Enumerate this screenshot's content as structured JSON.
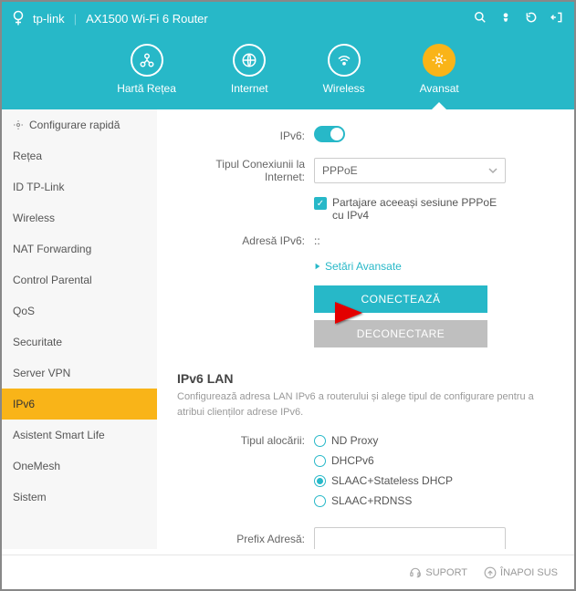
{
  "header": {
    "brand": "tp-link",
    "product": "AX1500 Wi-Fi 6 Router"
  },
  "tabs": [
    {
      "label": "Hartă Rețea"
    },
    {
      "label": "Internet"
    },
    {
      "label": "Wireless"
    },
    {
      "label": "Avansat"
    }
  ],
  "sidebar": {
    "items": [
      {
        "label": "Configurare rapidă",
        "icon": true
      },
      {
        "label": "Rețea"
      },
      {
        "label": "ID TP-Link"
      },
      {
        "label": "Wireless"
      },
      {
        "label": "NAT Forwarding"
      },
      {
        "label": "Control Parental"
      },
      {
        "label": "QoS"
      },
      {
        "label": "Securitate"
      },
      {
        "label": "Server VPN"
      },
      {
        "label": "IPv6",
        "active": true
      },
      {
        "label": "Asistent Smart Life"
      },
      {
        "label": "OneMesh"
      },
      {
        "label": "Sistem"
      }
    ]
  },
  "content": {
    "ipv6_label": "IPv6:",
    "conn_type_label": "Tipul Conexiunii la Internet:",
    "conn_type_value": "PPPoE",
    "share_label": "Partajare aceeași sesiune PPPoE cu IPv4",
    "addr_label": "Adresă IPv6:",
    "addr_value": "::",
    "adv_link": "Setări Avansate",
    "connect_btn": "CONECTEAZĂ",
    "disconnect_btn": "DECONECTARE",
    "lan_title": "IPv6 LAN",
    "lan_desc": "Configurează adresa LAN IPv6 a routerului și alege tipul de configurare pentru a atribui clienților adrese IPv6.",
    "alloc_label": "Tipul alocării:",
    "alloc_options": [
      "ND Proxy",
      "DHCPv6",
      "SLAAC+Stateless DHCP",
      "SLAAC+RDNSS"
    ],
    "alloc_selected": 2,
    "prefix_label": "Prefix Adresă:"
  },
  "footer": {
    "support": "SUPORT",
    "back_top": "ÎNAPOI SUS"
  }
}
